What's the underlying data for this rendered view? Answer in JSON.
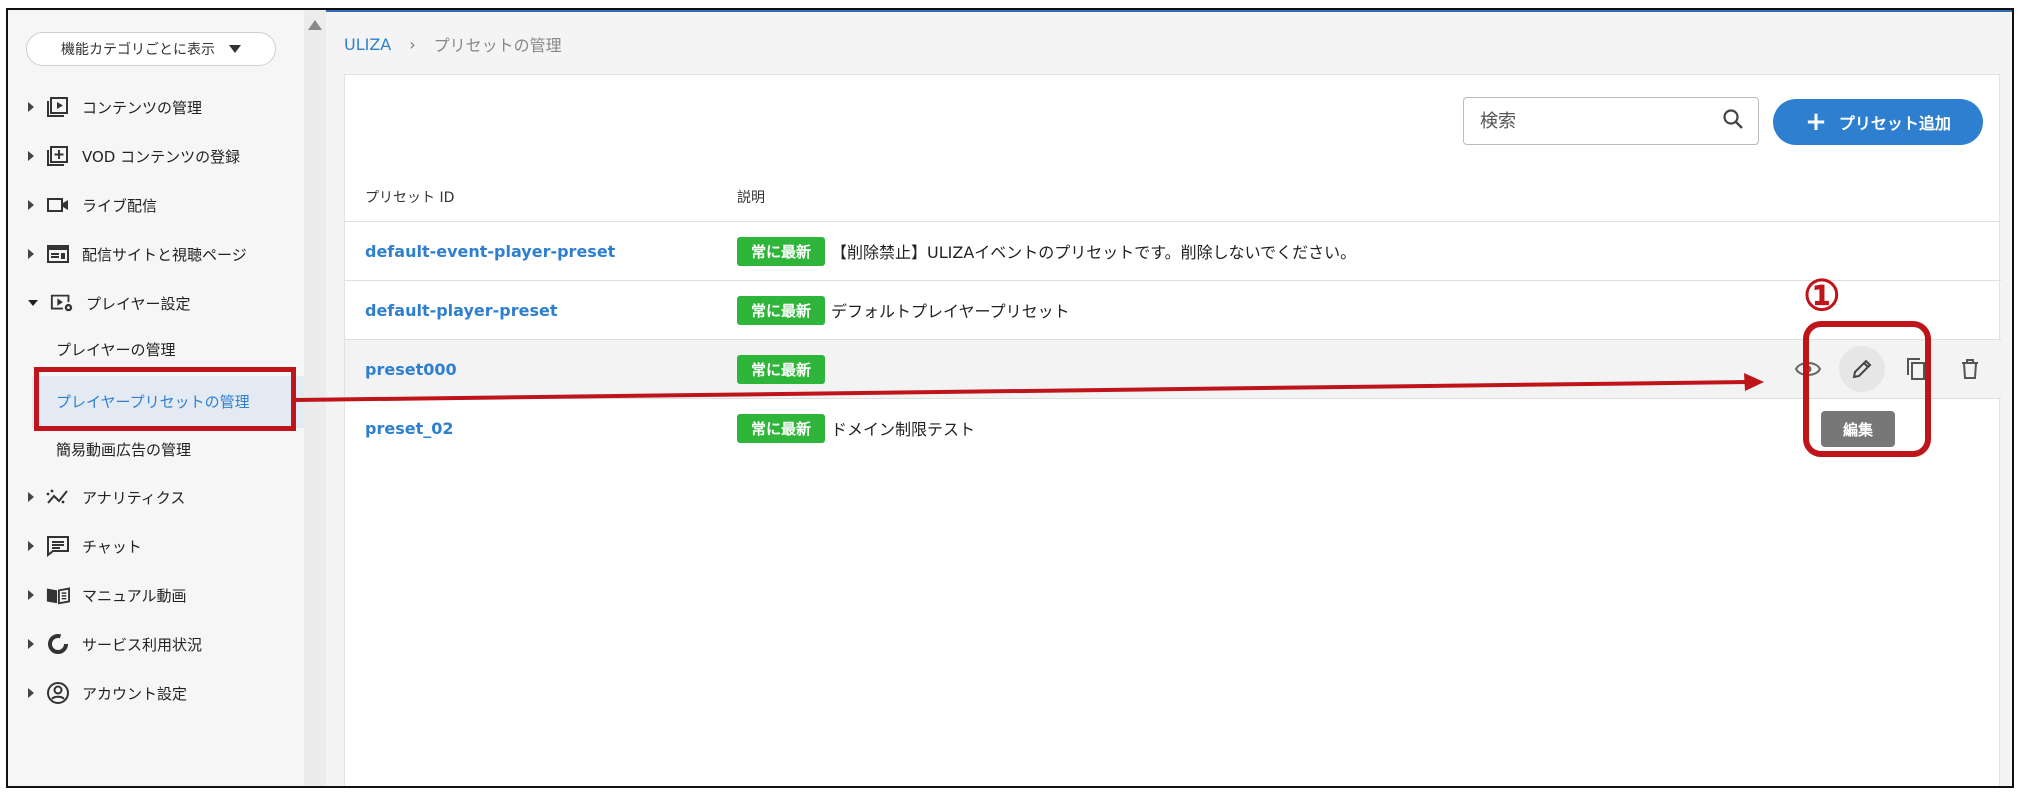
{
  "sidebar": {
    "category_button": "機能カテゴリごとに表示",
    "items": [
      {
        "label": "コンテンツの管理",
        "icon": "play-box-icon"
      },
      {
        "label": "VOD コンテンツの登録",
        "icon": "add-box-icon"
      },
      {
        "label": "ライブ配信",
        "icon": "video-camera-icon"
      },
      {
        "label": "配信サイトと視聴ページ",
        "icon": "web-page-icon"
      },
      {
        "label": "プレイヤー設定",
        "icon": "player-settings-icon"
      },
      {
        "label": "アナリティクス",
        "icon": "analytics-icon"
      },
      {
        "label": "チャット",
        "icon": "chat-icon"
      },
      {
        "label": "マニュアル動画",
        "icon": "manual-book-icon"
      },
      {
        "label": "サービス利用状況",
        "icon": "donut-chart-icon"
      },
      {
        "label": "アカウント設定",
        "icon": "account-icon"
      }
    ],
    "sub_items": [
      {
        "label": "プレイヤーの管理"
      },
      {
        "label": "プレイヤープリセットの管理"
      },
      {
        "label": "簡易動画広告の管理"
      }
    ]
  },
  "breadcrumb": {
    "root": "ULIZA",
    "separator": "›",
    "current": "プリセットの管理"
  },
  "toolbar": {
    "search_placeholder": "検索",
    "add_button": "プリセット追加"
  },
  "table": {
    "headers": {
      "id": "プリセット ID",
      "description": "説明"
    },
    "rows": [
      {
        "id": "default-event-player-preset",
        "badge": "常に最新",
        "description": "【削除禁止】ULIZAイベントのプリセットです。削除しないでください。"
      },
      {
        "id": "default-player-preset",
        "badge": "常に最新",
        "description": "デフォルトプレイヤープリセット"
      },
      {
        "id": "preset000",
        "badge": "常に最新",
        "description": ""
      },
      {
        "id": "preset_02",
        "badge": "常に最新",
        "description": "ドメイン制限テスト"
      }
    ]
  },
  "row_actions": {
    "tooltip": "編集"
  },
  "annotation": {
    "step_number": "①"
  },
  "colors": {
    "accent": "#2f7fd0",
    "badge": "#2fb63a",
    "annotation": "#c0141b"
  }
}
